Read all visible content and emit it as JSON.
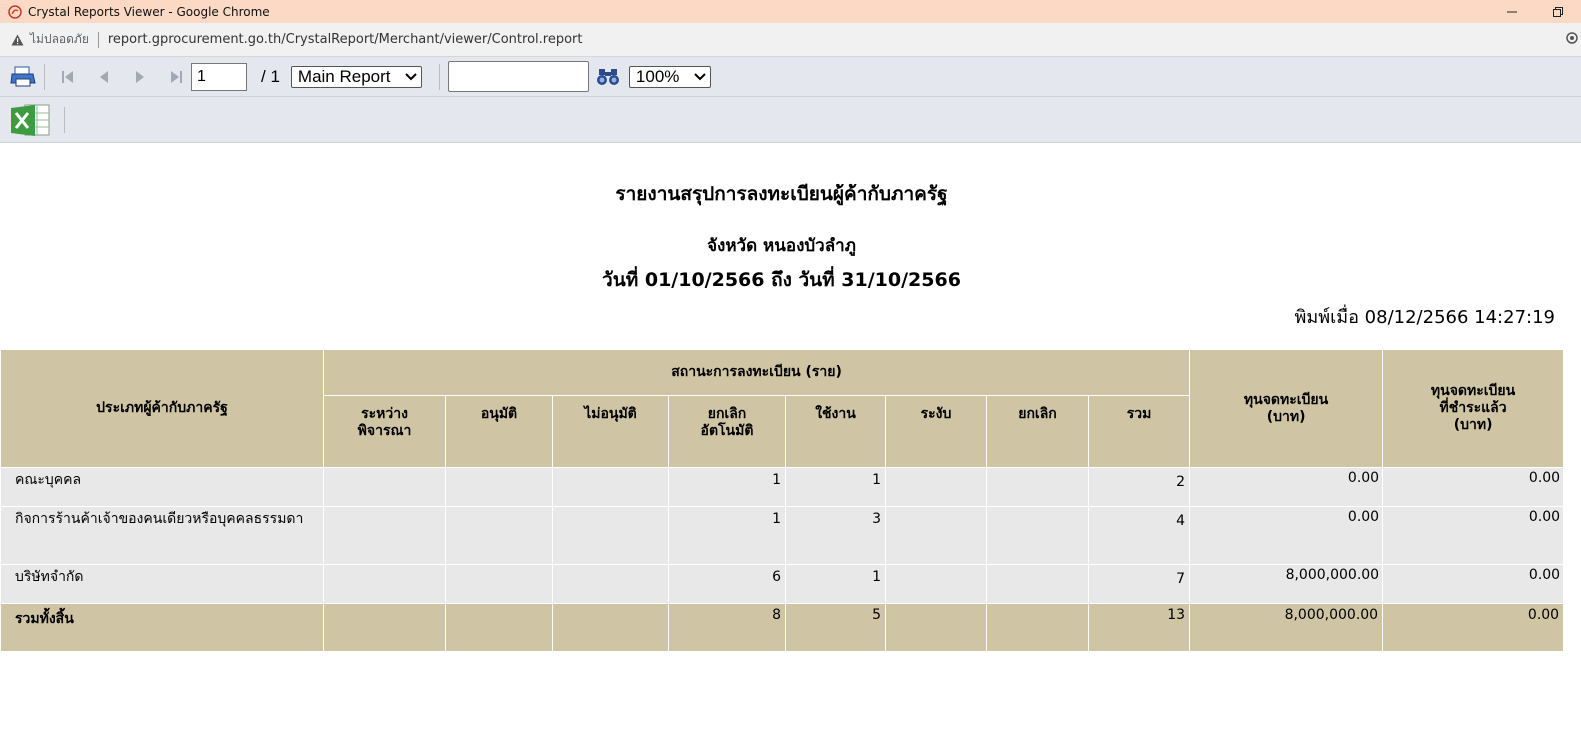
{
  "window": {
    "title": "Crystal Reports Viewer - Google Chrome"
  },
  "address": {
    "security_label": "ไม่ปลอดภัย",
    "url": "report.gprocurement.go.th/CrystalReport/Merchant/viewer/Control.report"
  },
  "toolbar": {
    "page_value": "1",
    "page_total": "/ 1",
    "report_select": "Main Report",
    "search_value": "",
    "zoom": "100%"
  },
  "report": {
    "title": "รายงานสรุปการลงทะเบียนผู้ค้ากับภาครัฐ",
    "province": "จังหวัด หนองบัวลำภู",
    "date_range": "วันที่ 01/10/2566 ถึง วันที่ 31/10/2566",
    "printed": "พิมพ์เมื่อ 08/12/2566  14:27:19"
  },
  "table": {
    "col_type": "ประเภทผู้ค้ากับภาครัฐ",
    "col_status": "สถานะการลงทะเบียน (ราย)",
    "col_capital_1": "ทุนจดทะเบียน",
    "col_capital_2": "(บาท)",
    "col_paid_1": "ทุนจดทะเบียน",
    "col_paid_2": "ที่ชำระแล้ว",
    "col_paid_3": "(บาท)",
    "sub": {
      "pending_1": "ระหว่าง",
      "pending_2": "พิจารณา",
      "approved": "อนุมัติ",
      "not_approved": "ไม่อนุมัติ",
      "auto_cancel_1": "ยกเลิก",
      "auto_cancel_2": "อัตโนมัติ",
      "active": "ใช้งาน",
      "suspended": "ระงับ",
      "cancelled": "ยกเลิก",
      "sum": "รวม"
    },
    "rows": [
      {
        "type": "คณะบุคคล",
        "pending": "",
        "approved": "",
        "not_approved": "",
        "auto_cancel": "1",
        "active": "1",
        "suspended": "",
        "cancelled": "",
        "sum": "2",
        "capital": "0.00",
        "paid": "0.00"
      },
      {
        "type": "กิจการร้านค้าเจ้าของคนเดียวหรือบุคคลธรรมดา",
        "pending": "",
        "approved": "",
        "not_approved": "",
        "auto_cancel": "1",
        "active": "3",
        "suspended": "",
        "cancelled": "",
        "sum": "4",
        "capital": "0.00",
        "paid": "0.00"
      },
      {
        "type": "บริษัทจำกัด",
        "pending": "",
        "approved": "",
        "not_approved": "",
        "auto_cancel": "6",
        "active": "1",
        "suspended": "",
        "cancelled": "",
        "sum": "7",
        "capital": "8,000,000.00",
        "paid": "0.00"
      }
    ],
    "total": {
      "type": "รวมทั้งสิ้น",
      "pending": "",
      "approved": "",
      "not_approved": "",
      "auto_cancel": "8",
      "active": "5",
      "suspended": "",
      "cancelled": "",
      "sum": "13",
      "capital": "8,000,000.00",
      "paid": "0.00"
    }
  }
}
